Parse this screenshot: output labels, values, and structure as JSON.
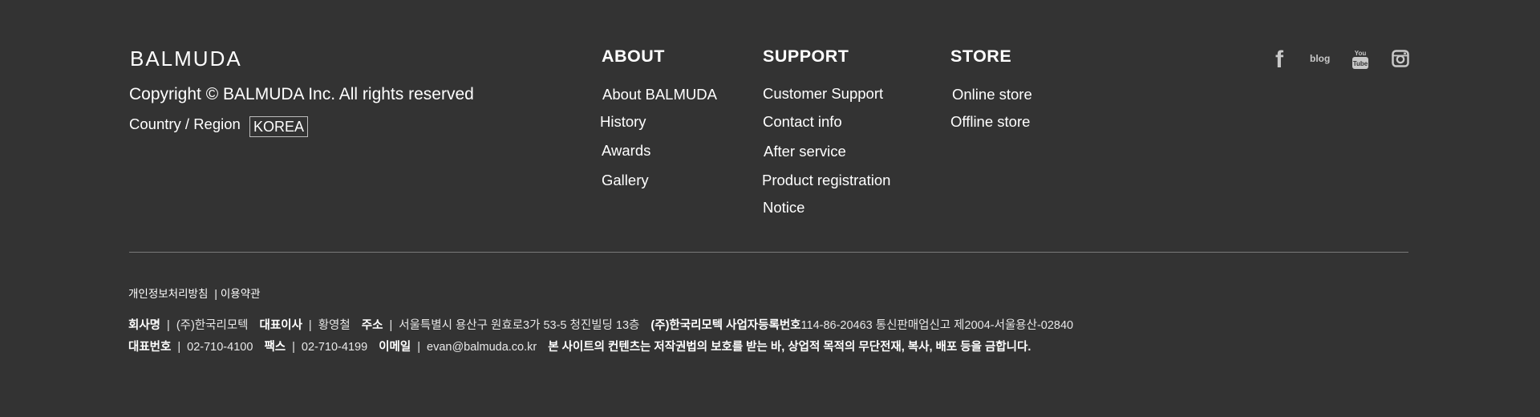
{
  "brand": {
    "logo": "BALMUDA",
    "copyright": "Copyright © BALMUDA Inc. All rights reserved",
    "region_label": "Country / Region",
    "region_value": "KOREA"
  },
  "about": {
    "title": "ABOUT",
    "items": [
      "About BALMUDA",
      "History",
      "Awards",
      "Gallery"
    ]
  },
  "support": {
    "title": "SUPPORT",
    "items": [
      "Customer Support",
      "Contact info",
      "After service",
      "Product registration",
      "Notice"
    ]
  },
  "store": {
    "title": "STORE",
    "items": [
      "Online store",
      "Offline store"
    ]
  },
  "social": {
    "facebook": "f",
    "blog": "blog",
    "youtube_icon": "youtube-icon",
    "instagram_icon": "instagram-icon"
  },
  "legal": {
    "privacy": "개인정보처리방침",
    "terms": "이용약관"
  },
  "company": {
    "company_label": "회사명",
    "company_value": "(주)한국리모텍",
    "ceo_label": "대표이사",
    "ceo_value": "황영철",
    "address_label": "주소",
    "address_value": "서울특별시 용산구 원효로3가 53-5 청진빌딩 13층",
    "biz_label": "(주)한국리모텍 사업자등록번호",
    "biz_value": "114-86-20463 통신판매업신고 제2004-서울용산-02840",
    "phone_label": "대표번호",
    "phone_value": "02-710-4100",
    "fax_label": "팩스",
    "fax_value": "02-710-4199",
    "email_label": "이메일",
    "email_value": "evan@balmuda.co.kr",
    "notice": "본 사이트의 컨텐츠는 저작권법의 보호를 받는 바, 상업적 목적의 무단전재, 복사, 배포 등을 금합니다."
  }
}
